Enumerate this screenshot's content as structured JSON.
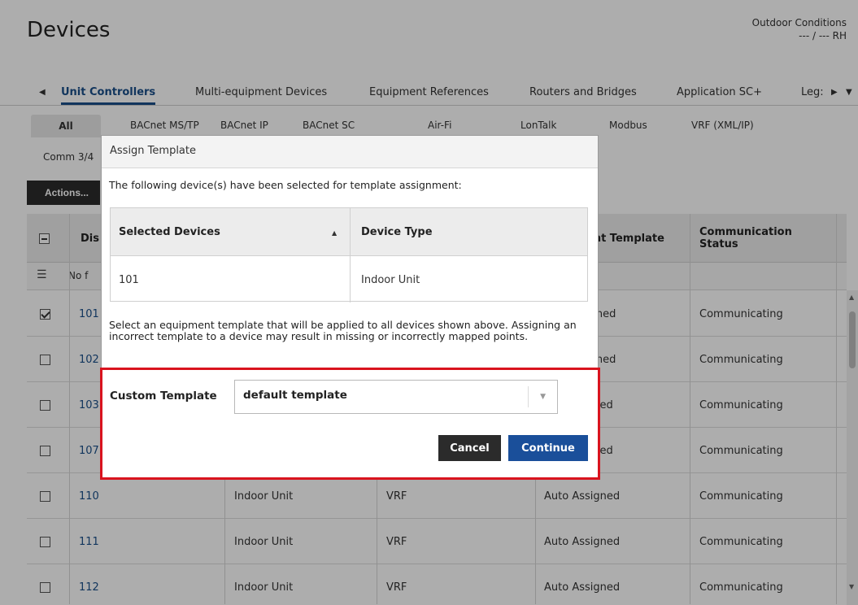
{
  "header": {
    "title": "Devices",
    "outdoor_label": "Outdoor Conditions",
    "outdoor_value": "--- / --- RH"
  },
  "primary_tabs": [
    {
      "label": "Unit Controllers",
      "active": true
    },
    {
      "label": "Multi-equipment Devices",
      "active": false
    },
    {
      "label": "Equipment References",
      "active": false
    },
    {
      "label": "Routers and Bridges",
      "active": false
    },
    {
      "label": "Application SC+",
      "active": false
    },
    {
      "label": "Leg:",
      "active": false
    }
  ],
  "secondary_tabs": [
    {
      "label": "All",
      "active": true
    },
    {
      "label": "BACnet MS/TP"
    },
    {
      "label": "BACnet IP"
    },
    {
      "label": "BACnet SC"
    },
    {
      "label": "Air-Fi"
    },
    {
      "label": "LonTalk"
    },
    {
      "label": "Modbus"
    },
    {
      "label": "VRF (XML/IP)"
    }
  ],
  "comm_tab": "Comm 3/4",
  "actions_label": "Actions...",
  "table": {
    "headers": {
      "display": "Dis",
      "template": "ent Template",
      "comm_status": "Communication Status"
    },
    "filter_text": "No f",
    "rows": [
      {
        "name": "101",
        "checked": true,
        "type": "",
        "protocol": "",
        "template": "igned",
        "status": "Communicating"
      },
      {
        "name": "102",
        "checked": false,
        "type": "",
        "protocol": "",
        "template": "igned",
        "status": "Communicating"
      },
      {
        "name": "103",
        "checked": false,
        "type": "",
        "protocol": "",
        "template": "gned",
        "status": "Communicating"
      },
      {
        "name": "107",
        "checked": false,
        "type": "",
        "protocol": "",
        "template": "gned",
        "status": "Communicating"
      },
      {
        "name": "110",
        "checked": false,
        "type": "Indoor Unit",
        "protocol": "VRF",
        "template": "Auto Assigned",
        "status": "Communicating"
      },
      {
        "name": "111",
        "checked": false,
        "type": "Indoor Unit",
        "protocol": "VRF",
        "template": "Auto Assigned",
        "status": "Communicating"
      },
      {
        "name": "112",
        "checked": false,
        "type": "Indoor Unit",
        "protocol": "VRF",
        "template": "Auto Assigned",
        "status": "Communicating"
      }
    ]
  },
  "modal": {
    "title": "Assign Template",
    "intro": "The following device(s) have been selected for template assignment:",
    "sel_headers": {
      "devices": "Selected Devices",
      "type": "Device Type"
    },
    "sel_rows": [
      {
        "device": "101",
        "type": "Indoor Unit"
      }
    ],
    "description": "Select an equipment template that will be applied to all devices shown above. Assigning an incorrect template to a device may result in missing or incorrectly mapped points.",
    "template_label": "Custom Template",
    "template_value": "default template",
    "cancel_label": "Cancel",
    "continue_label": "Continue"
  },
  "colors": {
    "accent": "#1a4f8a",
    "highlight": "#d9131e",
    "dark_button": "#2b2b2b"
  }
}
